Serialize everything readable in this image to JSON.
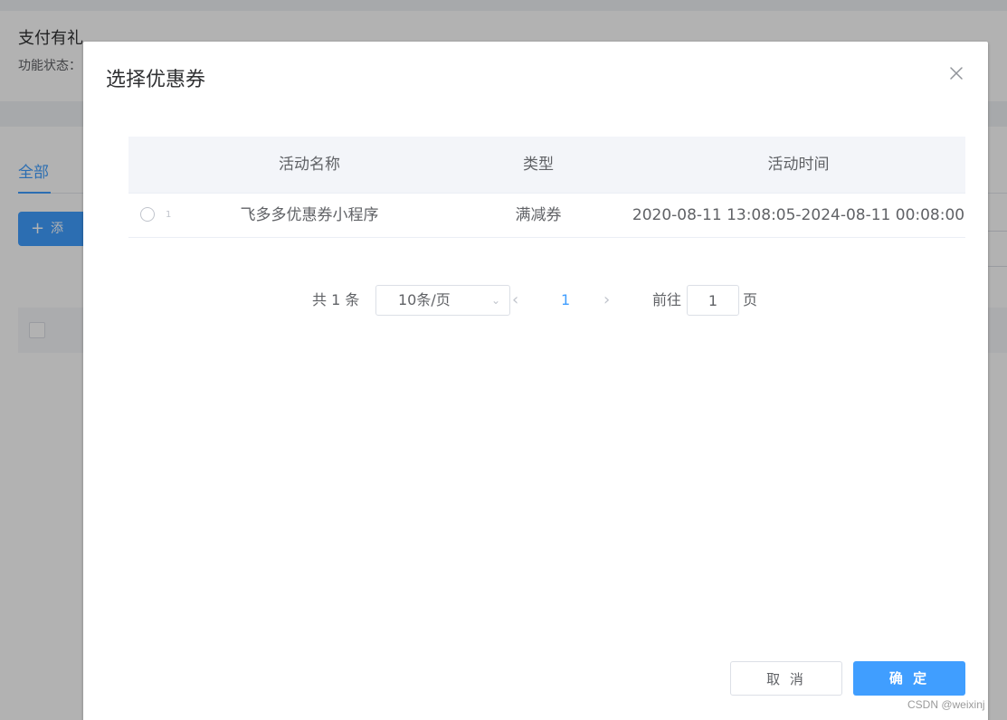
{
  "background": {
    "page_title": "支付有礼",
    "status_label": "功能状态：",
    "tab_all": "全部",
    "add_button": "添"
  },
  "dialog": {
    "title": "选择优惠券",
    "close_icon": "close-icon"
  },
  "table": {
    "columns": [
      "活动名称",
      "类型",
      "活动时间"
    ],
    "rows": [
      {
        "radio_label": "1",
        "name": "飞多多优惠券小程序",
        "type": "满减券",
        "time": "2020-08-11 13:08:05-2024-08-11 00:08:00"
      }
    ]
  },
  "pagination": {
    "total": "共 1 条",
    "page_size": "10条/页",
    "current_page": "1",
    "goto_label": "前往",
    "goto_value": "1",
    "page_unit": "页"
  },
  "footer": {
    "cancel_label": "取 消",
    "ok_label": "确 定"
  },
  "watermark": "CSDN @weixinj",
  "colors": {
    "primary": "#409eff",
    "mask": "rgba(0,0,0,0.3)"
  }
}
